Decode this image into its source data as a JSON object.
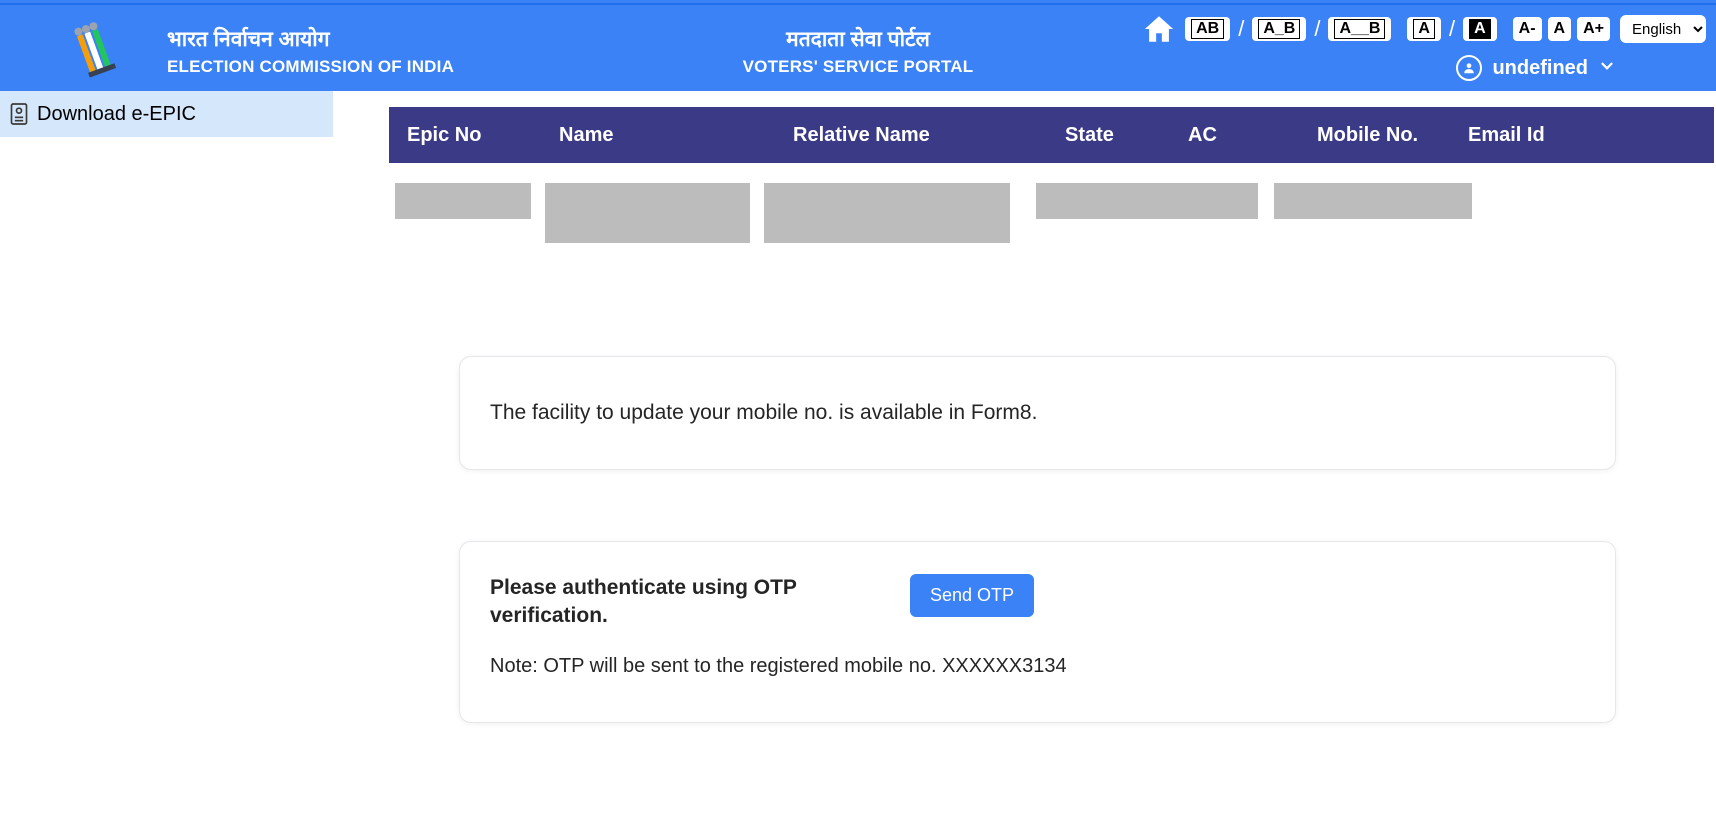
{
  "header": {
    "org_hindi": "भारत निर्वाचन आयोग",
    "org_en": "ELECTION COMMISSION OF INDIA",
    "portal_hindi": "मतदाता सेवा पोर्टल",
    "portal_en": "VOTERS' SERVICE PORTAL",
    "letter_spacing": {
      "ab": "AB",
      "a_b": "A_B",
      "a__b": "A__B",
      "theme_normal": "A",
      "theme_dark": "A"
    },
    "font_size": {
      "minus": "A-",
      "normal": "A",
      "plus": "A+"
    },
    "language": "English",
    "user_name": "undefined"
  },
  "sidebar": {
    "download_epic": "Download e-EPIC"
  },
  "table": {
    "headers": {
      "epic": "Epic No",
      "name": "Name",
      "relative": "Relative Name",
      "state": "State",
      "ac": "AC",
      "mobile": "Mobile No.",
      "email": "Email Id"
    }
  },
  "main": {
    "form8_info": "The facility to update your mobile no. is available in Form8.",
    "otp_prompt": "Please authenticate using OTP verification.",
    "send_otp": "Send OTP",
    "otp_note": "Note: OTP will be sent to the registered mobile no. XXXXXX3134"
  }
}
